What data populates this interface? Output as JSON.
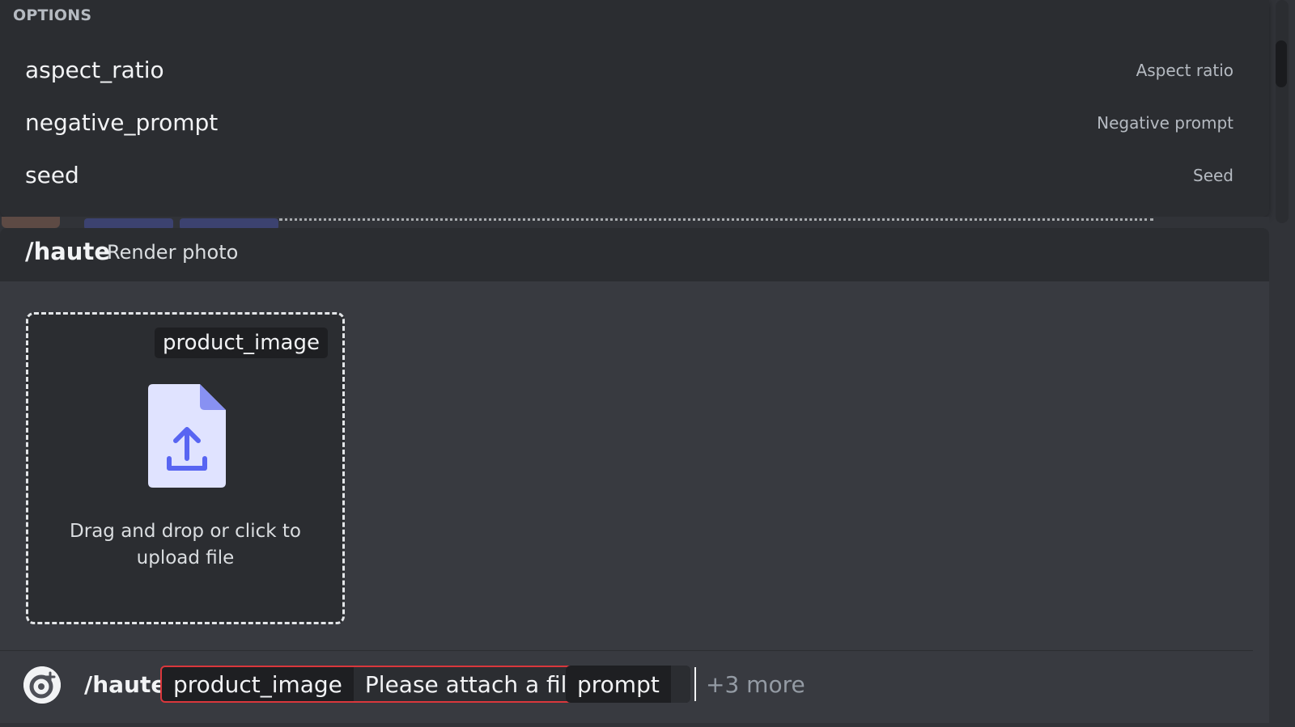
{
  "options_popup": {
    "header": "OPTIONS",
    "items": [
      {
        "name": "aspect_ratio",
        "description": "Aspect ratio"
      },
      {
        "name": "negative_prompt",
        "description": "Negative prompt"
      },
      {
        "name": "seed",
        "description": "Seed"
      }
    ]
  },
  "command": {
    "name": "/haute",
    "description": "Render photo"
  },
  "upload": {
    "label": "product_image",
    "hint_line1": "Drag and drop or click to",
    "hint_line2": "upload file",
    "icon": "file-upload-icon"
  },
  "input_bar": {
    "command": "/haute",
    "params": [
      {
        "name": "product_image",
        "value": "Please attach a file",
        "state": "error"
      },
      {
        "name": "prompt",
        "value": "",
        "state": "active"
      }
    ],
    "more": "+3 more"
  },
  "colors": {
    "background": "#313338",
    "panel": "#2b2d31",
    "error": "#da373c",
    "icon_fill": "#e0e3ff",
    "icon_accent": "#5865f2"
  }
}
